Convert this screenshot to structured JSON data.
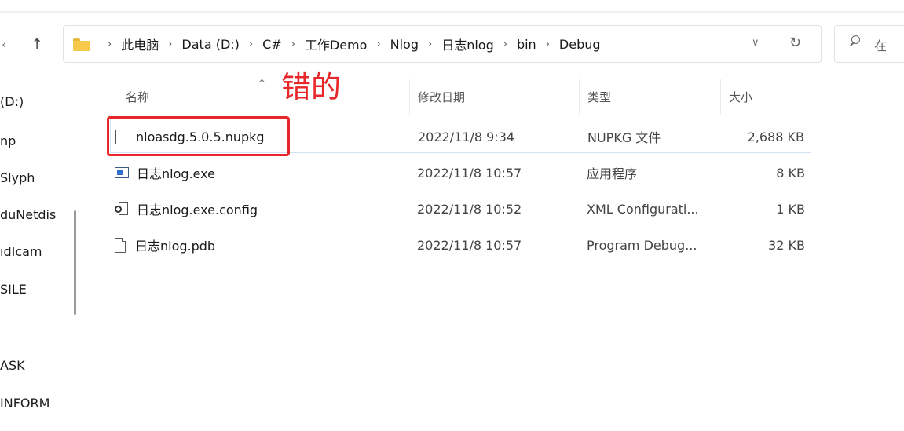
{
  "nav": {
    "up_glyph": "↑",
    "back_glyph": "‹",
    "breadcrumbs": [
      "此电脑",
      "Data (D:)",
      "C#",
      "工作Demo",
      "Nlog",
      "日志nlog",
      "bin",
      "Debug"
    ],
    "separator": "›",
    "dropdown_glyph": "∨",
    "refresh_glyph": "↻",
    "search_placeholder": "在 "
  },
  "sidebar": {
    "items": [
      "(D:)",
      "np",
      "Slyph",
      "duNetdis",
      "ıdIcam",
      "SILE",
      "ASK",
      "INFORM"
    ]
  },
  "columns": {
    "name": "名称",
    "date": "修改日期",
    "type": "类型",
    "size": "大小"
  },
  "sort_glyph": "^",
  "annotation": "错的",
  "files": [
    {
      "name": "nloasdg.5.0.5.nupkg",
      "date": "2022/11/8 9:34",
      "type": "NUPKG 文件",
      "size": "2,688 KB",
      "icon": "document-icon"
    },
    {
      "name": "日志nlog.exe",
      "date": "2022/11/8 10:57",
      "type": "应用程序",
      "size": "8 KB",
      "icon": "exe-icon"
    },
    {
      "name": "日志nlog.exe.config",
      "date": "2022/11/8 10:52",
      "type": "XML Configurati...",
      "size": "1 KB",
      "icon": "config-icon"
    },
    {
      "name": "日志nlog.pdb",
      "date": "2022/11/8 10:57",
      "type": "Program Debug...",
      "size": "32 KB",
      "icon": "document-icon"
    }
  ],
  "colors": {
    "annotation_red": "#e8272a",
    "selection_border": "#cfe4f7",
    "folder_yellow": "#f6c94a"
  }
}
